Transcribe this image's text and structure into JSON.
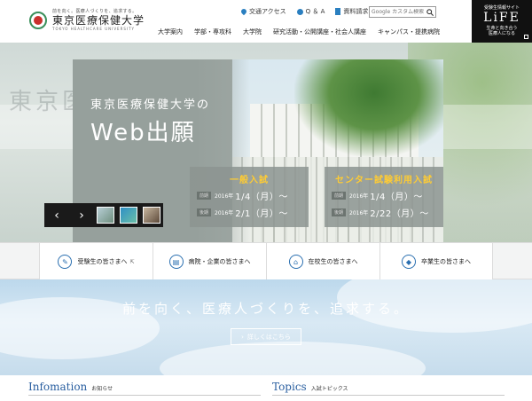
{
  "header": {
    "logo_tagline": "前を向く。医療人づくりを、追求する。",
    "logo_name": "東京医療保健大学",
    "logo_en": "TOKYO HEALTHCARE UNIVERSITY",
    "utility": [
      "交通アクセス",
      "Q ＆ A",
      "資料請求"
    ],
    "search_placeholder": "Google カスタム検索",
    "nav": [
      "大学案内",
      "学部・専攻科",
      "大学院",
      "研究活動・公開講座・社会人講座",
      "キャンパス・提携病院"
    ],
    "life": {
      "line1": "受験生情報サイト",
      "title": "LiFE",
      "line2": "生命と向き合う",
      "line3": "医療人になる"
    }
  },
  "hero": {
    "bg_text": "東京医療保健大学",
    "banner_title1": "東京医療保健大学の",
    "banner_title2": "Web出願",
    "exams": [
      {
        "title": "一般入試",
        "rows": [
          {
            "tag": "前期",
            "year": "2016年",
            "date": "1/4（月）〜"
          },
          {
            "tag": "後期",
            "year": "2016年",
            "date": "2/1（月）〜"
          }
        ]
      },
      {
        "title": "センター試験利用入試",
        "rows": [
          {
            "tag": "前期",
            "year": "2016年",
            "date": "1/4（月）〜"
          },
          {
            "tag": "後期",
            "year": "2016年",
            "date": "2/22（月）〜"
          }
        ]
      }
    ],
    "slider": {
      "prev": "‹",
      "next": "›"
    }
  },
  "targets": [
    {
      "label": "受験生の皆さまへ",
      "icon": "pencil-icon",
      "glyph": "✎",
      "ext": "⇱"
    },
    {
      "label": "病院・企業の皆さまへ",
      "icon": "document-icon",
      "glyph": "▤",
      "ext": ""
    },
    {
      "label": "在校生の皆さまへ",
      "icon": "building-icon",
      "glyph": "⌂",
      "ext": ""
    },
    {
      "label": "卒業生の皆さまへ",
      "icon": "graduation-cap-icon",
      "glyph": "◆",
      "ext": ""
    }
  ],
  "slogan": {
    "message": "前を向く、医療人づくりを、追求する。",
    "more": "詳しくはこちら"
  },
  "news": {
    "info_en": "Infomation",
    "info_ja": "お知らせ",
    "topics_en": "Topics",
    "topics_ja": "入試トピックス"
  },
  "colors": {
    "accent": "#2a5fa0",
    "exam_title": "#ffcc33",
    "life_bg": "#111111"
  }
}
